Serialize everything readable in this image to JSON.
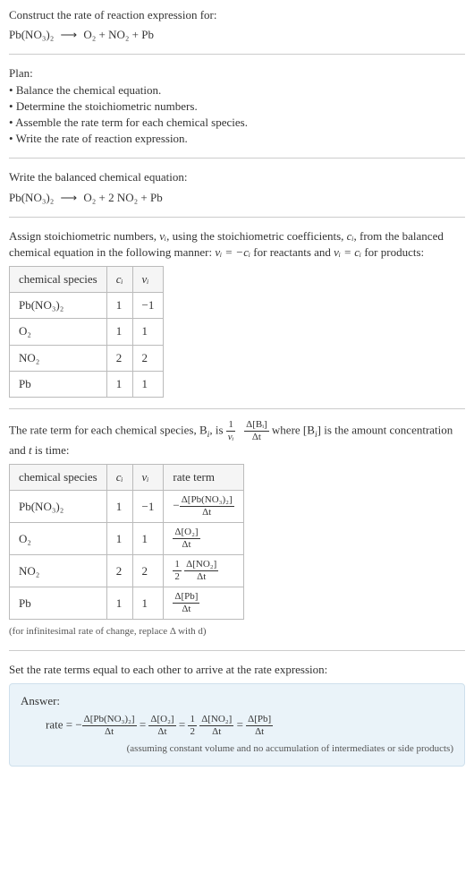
{
  "header": {
    "construct_label": "Construct the rate of reaction expression for:",
    "unbalanced_lhs": "Pb(NO₃)₂",
    "arrow": "⟶",
    "unbalanced_rhs": "O₂ + NO₂ + Pb"
  },
  "plan": {
    "title": "Plan:",
    "items": [
      "Balance the chemical equation.",
      "Determine the stoichiometric numbers.",
      "Assemble the rate term for each chemical species.",
      "Write the rate of reaction expression."
    ]
  },
  "balanced": {
    "title": "Write the balanced chemical equation:",
    "lhs": "Pb(NO₃)₂",
    "arrow": "⟶",
    "rhs": "O₂ + 2 NO₂ + Pb"
  },
  "stoich_text": {
    "prefix": "Assign stoichiometric numbers, ",
    "nu_i": "νᵢ",
    "mid1": ", using the stoichiometric coefficients, ",
    "c_i": "cᵢ",
    "mid2": ", from the balanced chemical equation in the following manner: ",
    "rel1": "νᵢ = −cᵢ",
    "mid3": " for reactants and ",
    "rel2": "νᵢ = cᵢ",
    "mid4": " for products:"
  },
  "table1": {
    "headers": [
      "chemical species",
      "cᵢ",
      "νᵢ"
    ],
    "rows": [
      {
        "species": "Pb(NO₃)₂",
        "c": "1",
        "nu": "−1"
      },
      {
        "species": "O₂",
        "c": "1",
        "nu": "1"
      },
      {
        "species": "NO₂",
        "c": "2",
        "nu": "2"
      },
      {
        "species": "Pb",
        "c": "1",
        "nu": "1"
      }
    ]
  },
  "rateterm_text": {
    "prefix": "The rate term for each chemical species, B",
    "sub_i": "i",
    "mid1": ", is ",
    "frac1_num": "1",
    "frac1_den": "νᵢ",
    "frac2_num": "Δ[Bᵢ]",
    "frac2_den": "Δt",
    "mid2": " where [B",
    "mid3": "] is the amount concentration and ",
    "t": "t",
    "mid4": " is time:"
  },
  "table2": {
    "headers": [
      "chemical species",
      "cᵢ",
      "νᵢ",
      "rate term"
    ],
    "rows": [
      {
        "species": "Pb(NO₃)₂",
        "c": "1",
        "nu": "−1",
        "rt_prefix": "−",
        "rt_coef_num": "",
        "rt_coef_den": "",
        "rt_num": "Δ[Pb(NO₃)₂]",
        "rt_den": "Δt"
      },
      {
        "species": "O₂",
        "c": "1",
        "nu": "1",
        "rt_prefix": "",
        "rt_coef_num": "",
        "rt_coef_den": "",
        "rt_num": "Δ[O₂]",
        "rt_den": "Δt"
      },
      {
        "species": "NO₂",
        "c": "2",
        "nu": "2",
        "rt_prefix": "",
        "rt_coef_num": "1",
        "rt_coef_den": "2",
        "rt_num": "Δ[NO₂]",
        "rt_den": "Δt"
      },
      {
        "species": "Pb",
        "c": "1",
        "nu": "1",
        "rt_prefix": "",
        "rt_coef_num": "",
        "rt_coef_den": "",
        "rt_num": "Δ[Pb]",
        "rt_den": "Δt"
      }
    ],
    "footnote": "(for infinitesimal rate of change, replace Δ with d)"
  },
  "final": {
    "title": "Set the rate terms equal to each other to arrive at the rate expression:",
    "answer_label": "Answer:",
    "rate_label": "rate = ",
    "neg": "−",
    "t1_num": "Δ[Pb(NO₃)₂]",
    "t1_den": "Δt",
    "eq": " = ",
    "t2_num": "Δ[O₂]",
    "t2_den": "Δt",
    "t3_coef_num": "1",
    "t3_coef_den": "2",
    "t3_num": "Δ[NO₂]",
    "t3_den": "Δt",
    "t4_num": "Δ[Pb]",
    "t4_den": "Δt",
    "assumption": "(assuming constant volume and no accumulation of intermediates or side products)"
  },
  "chart_data": {
    "type": "table",
    "tables": [
      {
        "title": "Stoichiometric numbers",
        "columns": [
          "chemical species",
          "c_i",
          "nu_i"
        ],
        "rows": [
          [
            "Pb(NO3)2",
            1,
            -1
          ],
          [
            "O2",
            1,
            1
          ],
          [
            "NO2",
            2,
            2
          ],
          [
            "Pb",
            1,
            1
          ]
        ]
      },
      {
        "title": "Rate terms",
        "columns": [
          "chemical species",
          "c_i",
          "nu_i",
          "rate term"
        ],
        "rows": [
          [
            "Pb(NO3)2",
            1,
            -1,
            "-Δ[Pb(NO3)2]/Δt"
          ],
          [
            "O2",
            1,
            1,
            "Δ[O2]/Δt"
          ],
          [
            "NO2",
            2,
            2,
            "(1/2) Δ[NO2]/Δt"
          ],
          [
            "Pb",
            1,
            1,
            "Δ[Pb]/Δt"
          ]
        ]
      }
    ]
  }
}
